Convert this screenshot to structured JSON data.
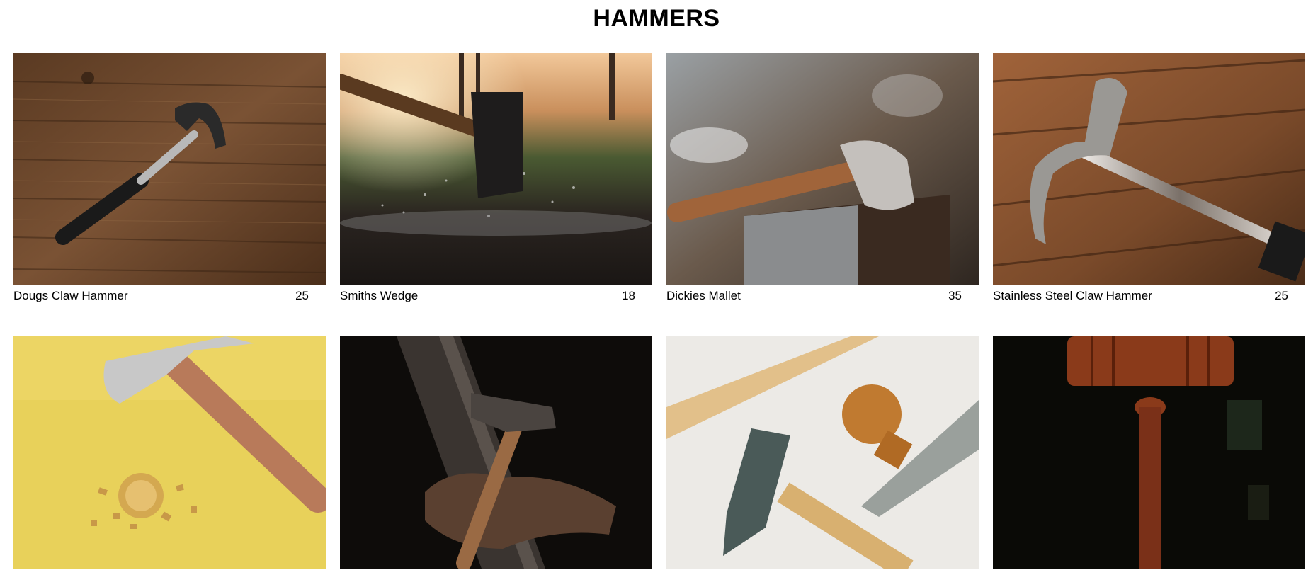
{
  "page": {
    "title": "HAMMERS"
  },
  "products": [
    {
      "name": "Dougs Claw Hammer",
      "price": "25",
      "image_icon": "claw-hammer-on-wood-photo"
    },
    {
      "name": "Smiths Wedge",
      "price": "18",
      "image_icon": "sledgehammer-striking-ground-photo"
    },
    {
      "name": "Dickies Mallet",
      "price": "35",
      "image_icon": "hammer-on-anvil-photo"
    },
    {
      "name": "Stainless Steel Claw Hammer",
      "price": "25",
      "image_icon": "steel-claw-hammer-photo"
    },
    {
      "name": "",
      "price": "",
      "image_icon": "hammer-with-gold-coin-photo"
    },
    {
      "name": "",
      "price": "",
      "image_icon": "hammer-with-gloves-on-anvil-photo"
    },
    {
      "name": "",
      "price": "",
      "image_icon": "hammer-and-wood-plane-photo"
    },
    {
      "name": "",
      "price": "",
      "image_icon": "gavel-photo"
    }
  ]
}
